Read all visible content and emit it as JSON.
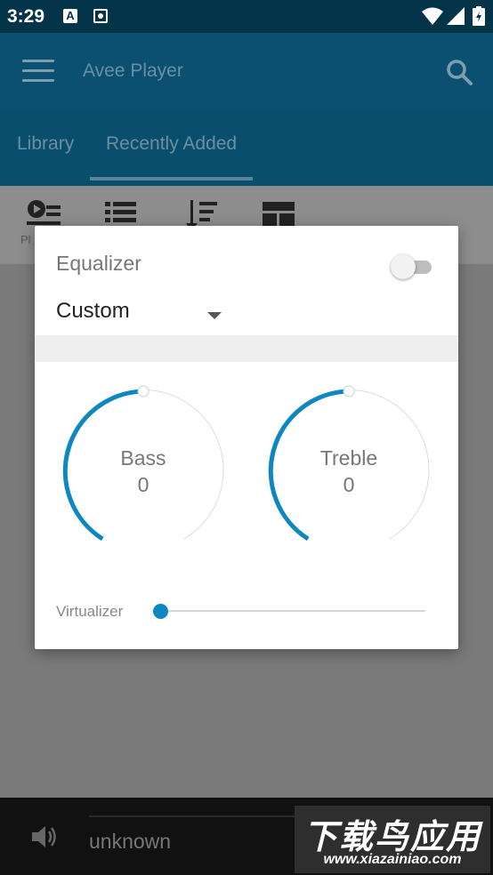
{
  "status_bar": {
    "time": "3:29",
    "icons": [
      "notification-a-icon",
      "screen-record-icon",
      "wifi-icon",
      "cellular-icon",
      "battery-icon"
    ]
  },
  "app_bar": {
    "title": "Avee Player",
    "icons": [
      "menu-icon",
      "search-icon"
    ]
  },
  "tabs": [
    {
      "label": "Library",
      "selected": false
    },
    {
      "label": "Recently Added",
      "selected": true
    }
  ],
  "toolbar": {
    "partial_label": "Pl"
  },
  "bottom_bar": {
    "now_playing": "unknown"
  },
  "watermark": {
    "main": "下载鸟应用",
    "sub": "www.xiazainiao.com"
  },
  "dialog": {
    "title": "Equalizer",
    "enabled": false,
    "preset": "Custom",
    "knobs": [
      {
        "label": "Bass",
        "value": "0"
      },
      {
        "label": "Treble",
        "value": "0"
      }
    ],
    "virtualizer": {
      "label": "Virtualizer",
      "level": 0
    }
  },
  "colors": {
    "accent": "#0d87c2",
    "status_bar": "#04344a",
    "app_bar": "#0b5070",
    "dim_overlay": "#7a7a7a"
  }
}
